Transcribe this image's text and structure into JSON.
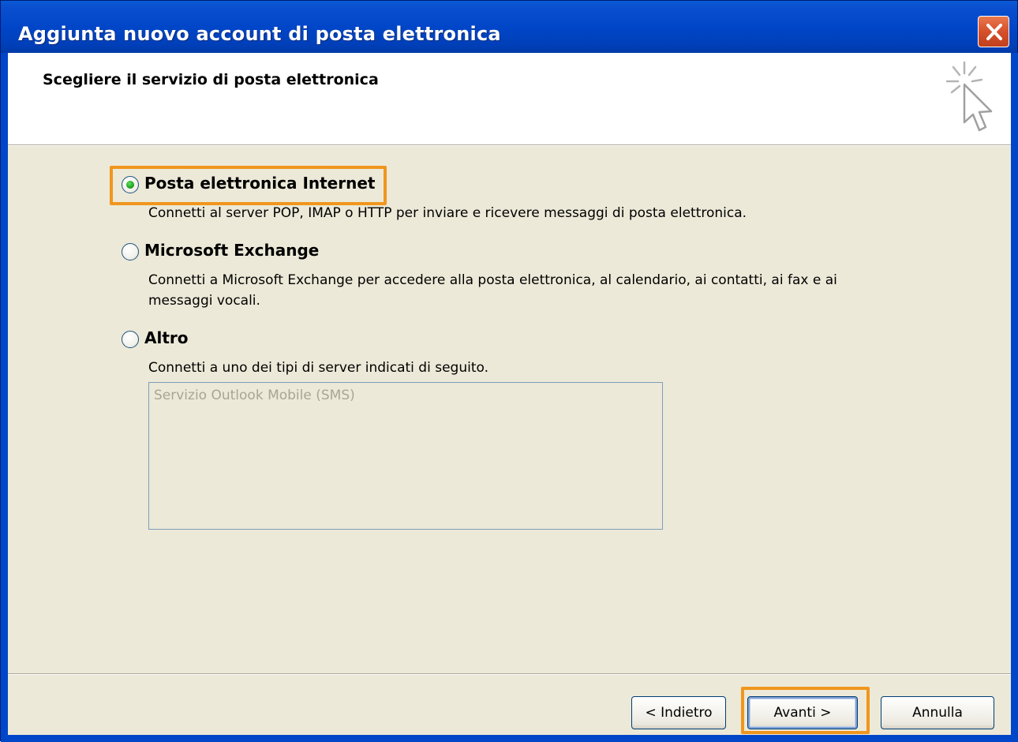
{
  "window": {
    "title": "Aggiunta nuovo account di posta elettronica",
    "close_icon": "close-x-icon"
  },
  "header": {
    "title": "Scegliere il servizio di posta elettronica",
    "icon": "wizard-cursor-sparkle-icon"
  },
  "options": [
    {
      "label": "Posta elettronica Internet",
      "description": "Connetti al server POP, IMAP o HTTP per inviare e ricevere messaggi di posta elettronica.",
      "selected": true
    },
    {
      "label": "Microsoft Exchange",
      "description_line1": "Connetti a Microsoft Exchange per accedere alla posta elettronica, al calendario, ai contatti, ai fax e ai",
      "description_line2": "messaggi vocali.",
      "selected": false
    },
    {
      "label": "Altro",
      "description": "Connetti a uno dei tipi di server indicati di seguito.",
      "selected": false,
      "list_items": [
        "Servizio Outlook Mobile (SMS)"
      ]
    }
  ],
  "buttons": {
    "back": "< Indietro",
    "next": "Avanti >",
    "cancel": "Annulla"
  },
  "colors": {
    "titlebar": "#0046c8",
    "dialog_bg": "#ece9d8",
    "highlight": "#f0961e",
    "radio_dot": "#21a121"
  }
}
